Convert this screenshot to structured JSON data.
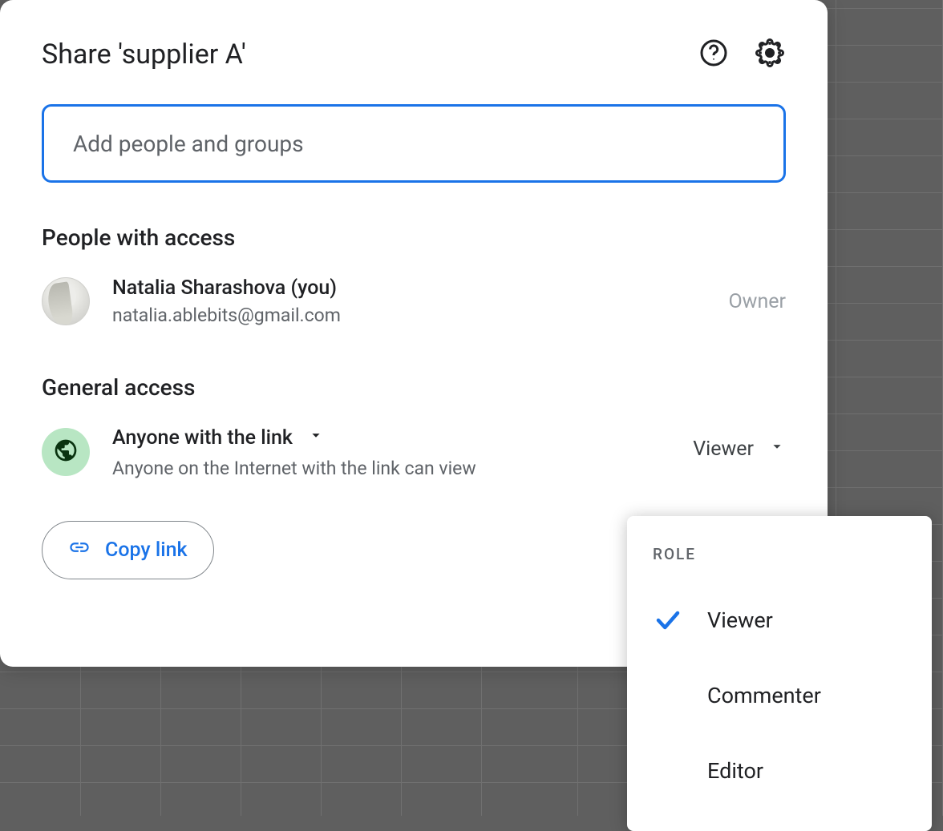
{
  "dialog": {
    "title": "Share 'supplier A'",
    "input_placeholder": "Add people and groups"
  },
  "sections": {
    "people_heading": "People with access",
    "general_heading": "General access"
  },
  "person": {
    "name": "Natalia Sharashova (you)",
    "email": "natalia.ablebits@gmail.com",
    "role": "Owner"
  },
  "general": {
    "scope_label": "Anyone with the link",
    "description": "Anyone on the Internet with the link can view",
    "role_label": "Viewer"
  },
  "actions": {
    "copy_link": "Copy link"
  },
  "dropdown": {
    "header": "ROLE",
    "options": {
      "viewer": "Viewer",
      "commenter": "Commenter",
      "editor": "Editor"
    }
  }
}
